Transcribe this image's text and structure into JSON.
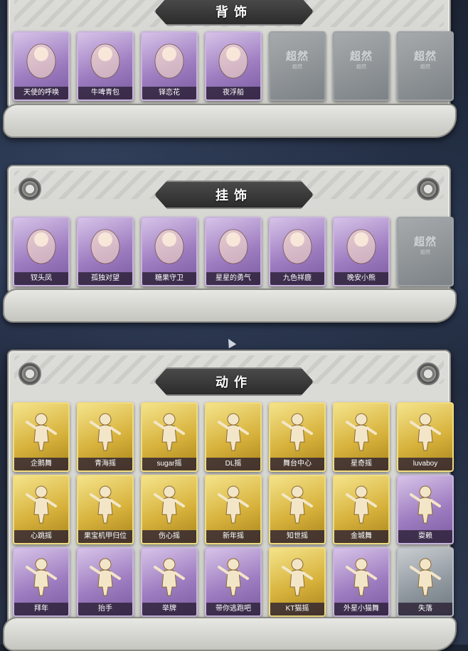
{
  "sections": [
    {
      "title": "背饰",
      "items": [
        {
          "label": "天使的呼唤",
          "style": "purple",
          "icon": "angel-ornament-icon"
        },
        {
          "label": "牛啤青包",
          "style": "purple",
          "icon": "pig-beer-mug-icon"
        },
        {
          "label": "铎恋花",
          "style": "purple",
          "icon": "bell-flower-icon"
        },
        {
          "label": "夜浮船",
          "style": "purple",
          "icon": "jellyfish-icon"
        },
        {
          "label": "",
          "style": "locked",
          "icon": "locked-placeholder-icon",
          "watermark": "超然",
          "watermark_sub": "超然"
        },
        {
          "label": "",
          "style": "locked",
          "icon": "locked-placeholder-icon",
          "watermark": "超然",
          "watermark_sub": "超然"
        },
        {
          "label": "",
          "style": "locked",
          "icon": "locked-placeholder-icon",
          "watermark": "超然",
          "watermark_sub": "超然"
        }
      ]
    },
    {
      "title": "挂饰",
      "items": [
        {
          "label": "钗头凤",
          "style": "purple",
          "icon": "phoenix-crown-icon"
        },
        {
          "label": "孤独对望",
          "style": "purple",
          "icon": "doll-charm-icon"
        },
        {
          "label": "糖果守卫",
          "style": "purple",
          "icon": "pumpkin-charm-icon"
        },
        {
          "label": "星星的勇气",
          "style": "purple",
          "icon": "star-prince-charm-icon"
        },
        {
          "label": "九色祥鹿",
          "style": "purple",
          "icon": "deer-charm-icon"
        },
        {
          "label": "晚安小熊",
          "style": "purple",
          "icon": "teddy-bear-charm-icon"
        },
        {
          "label": "",
          "style": "locked",
          "icon": "locked-placeholder-icon",
          "watermark": "超然",
          "watermark_sub": "超然"
        }
      ]
    },
    {
      "title": "动作",
      "rows": [
        [
          {
            "label": "企鹅舞",
            "style": "gold",
            "icon": "emote-figure-icon"
          },
          {
            "label": "青海摇",
            "style": "gold",
            "icon": "emote-figure-icon"
          },
          {
            "label": "sugar摇",
            "style": "gold",
            "icon": "emote-figure-icon"
          },
          {
            "label": "DL摇",
            "style": "gold",
            "icon": "emote-figure-icon"
          },
          {
            "label": "舞台中心",
            "style": "gold",
            "icon": "emote-figure-icon"
          },
          {
            "label": "星奇摇",
            "style": "gold",
            "icon": "emote-figure-icon"
          },
          {
            "label": "luvaboy",
            "style": "gold",
            "icon": "emote-figure-icon"
          }
        ],
        [
          {
            "label": "心跳摇",
            "style": "gold",
            "icon": "emote-figure-icon"
          },
          {
            "label": "果宝机甲归位",
            "style": "gold",
            "icon": "emote-figure-icon"
          },
          {
            "label": "伤心摇",
            "style": "gold",
            "icon": "emote-figure-icon"
          },
          {
            "label": "新年摇",
            "style": "gold",
            "icon": "emote-figure-icon"
          },
          {
            "label": "知世摇",
            "style": "gold",
            "icon": "emote-figure-icon"
          },
          {
            "label": "金城舞",
            "style": "gold",
            "icon": "emote-figure-icon"
          },
          {
            "label": "耍赖",
            "style": "purple",
            "icon": "emote-figure-icon"
          }
        ],
        [
          {
            "label": "拜年",
            "style": "purple",
            "icon": "emote-figure-icon"
          },
          {
            "label": "抬手",
            "style": "purple",
            "icon": "emote-figure-icon"
          },
          {
            "label": "举牌",
            "style": "purple",
            "icon": "emote-figure-icon"
          },
          {
            "label": "带你逃跑吧",
            "style": "purple",
            "icon": "emote-figure-icon"
          },
          {
            "label": "KT猫摇",
            "style": "gold",
            "icon": "emote-figure-icon"
          },
          {
            "label": "外星小猫舞",
            "style": "purple",
            "icon": "emote-figure-icon"
          },
          {
            "label": "失落",
            "style": "grey",
            "icon": "emote-figure-icon"
          }
        ]
      ]
    }
  ],
  "colors": {
    "purple_card": "#9e7cc0",
    "gold_card": "#d7b23c",
    "grey_card": "#8c949c",
    "locked_card": "#7d8286",
    "panel": "#d6d6d2",
    "banner": "#3a3a3a"
  }
}
